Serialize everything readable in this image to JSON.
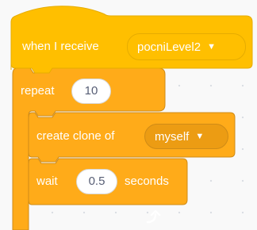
{
  "colors": {
    "events": "#ffbf00",
    "events_border": "#e6ac00",
    "control": "#ffab19",
    "control_border": "#cf8b17",
    "control_dark": "#ec9c13",
    "canvas_bg": "#f9f9f9",
    "input_text": "#575e75"
  },
  "hat_block": {
    "label": "when I receive",
    "message_dropdown": {
      "value": "pocniLevel2",
      "icon": "caret-down-icon"
    }
  },
  "repeat_block": {
    "label": "repeat",
    "times_value": "10",
    "loop_icon": "loop-arrow-icon"
  },
  "create_clone_block": {
    "label": "create clone of",
    "target_dropdown": {
      "value": "myself",
      "icon": "caret-down-icon"
    }
  },
  "wait_block": {
    "label_before": "wait",
    "seconds_value": "0.5",
    "label_after": "seconds"
  }
}
